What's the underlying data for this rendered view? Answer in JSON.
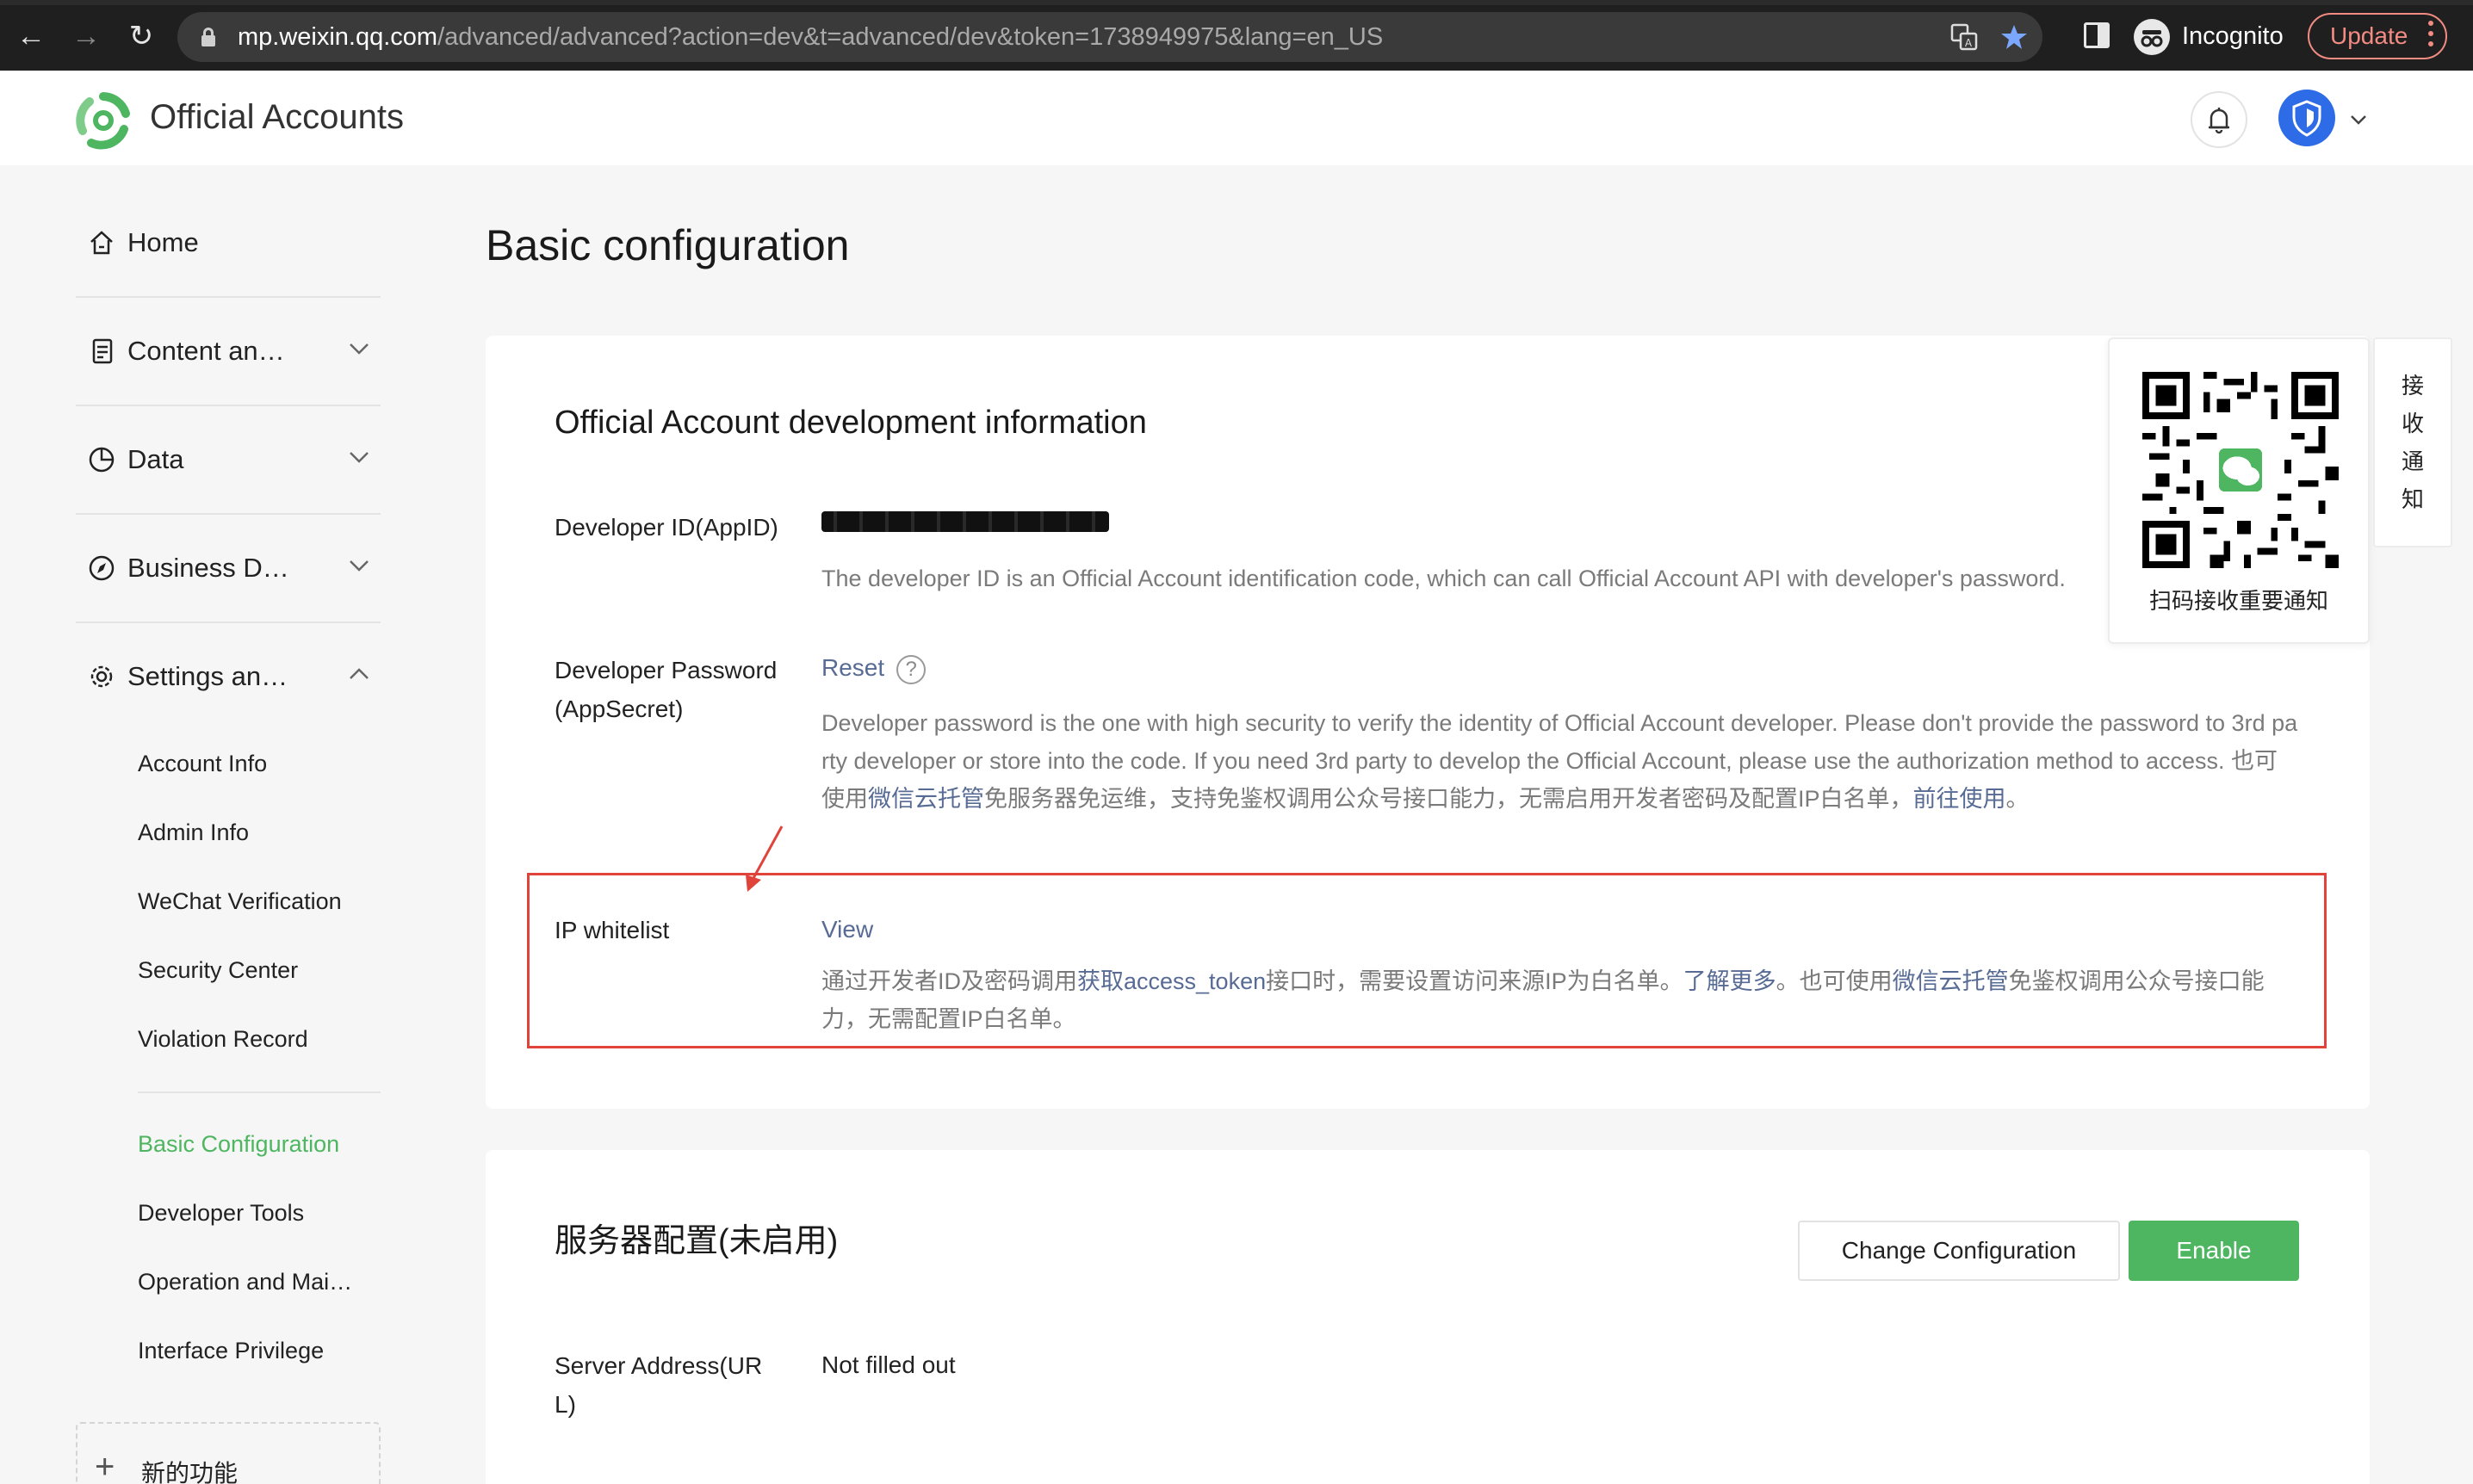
{
  "browser": {
    "url_host": "mp.weixin.qq.com",
    "url_path": "/advanced/advanced?action=dev&t=advanced/dev&token=1738949975&lang=en_US",
    "incognito_label": "Incognito",
    "update_label": "Update",
    "colors": {
      "frame": "#1f1f1f",
      "omnibox": "#3a3a3a",
      "update": "#f28b82",
      "star": "#7ba7ff"
    }
  },
  "header": {
    "brand": "Official Accounts",
    "colors": {
      "logo_green": "#4eb660",
      "avatar_blue": "#2e6be6"
    }
  },
  "sidebar": {
    "items": [
      {
        "label": "Home",
        "icon": "home-icon"
      },
      {
        "label": "Content and Interaction",
        "icon": "document-icon",
        "expanded": false
      },
      {
        "label": "Data",
        "icon": "pie-chart-icon",
        "expanded": false
      },
      {
        "label": "Business Development",
        "icon": "compass-icon",
        "expanded": false
      },
      {
        "label": "Settings and Development",
        "icon": "gear-icon",
        "expanded": true
      }
    ],
    "settings_children": [
      "Account Info",
      "Admin Info",
      "WeChat Verification",
      "Security Center",
      "Violation Record"
    ],
    "dev_children": [
      "Basic Configuration",
      "Developer Tools",
      "Operation and Maintenance",
      "Interface Privilege"
    ],
    "active": "Basic Configuration",
    "new_feature": "新的功能",
    "active_color": "#4eb660"
  },
  "main": {
    "page_title": "Basic configuration",
    "dev_info": {
      "title": "Official Account development information",
      "appid_label": "Developer ID(AppID)",
      "appid_desc": "The developer ID is an Official Account identification code, which can call Official Account API with developer's password.",
      "secret_label": "Developer Password(AppSecret)",
      "secret_action": "Reset",
      "secret_help": "?",
      "secret_desc_1": "Developer password is the one with high security to verify the identity of Official Account developer. Please don't provide the password to 3rd party developer or store into the code. If you need 3rd party to develop the Official Account, please use the authorization method to access. 也可使用",
      "secret_desc_link_1": "微信云托管",
      "secret_desc_2": "免服务器免运维，支持免鉴权调用公众号接口能力，无需启用开发者密码及配置IP白名单，",
      "secret_desc_link_2": "前往使用",
      "secret_desc_3": "。",
      "ip_label": "IP whitelist",
      "ip_action": "View",
      "ip_desc_1": "通过开发者ID及密码调用",
      "ip_desc_link_1": "获取access_token",
      "ip_desc_2": "接口时，需要设置访问来源IP为白名单。",
      "ip_desc_link_2": "了解更多",
      "ip_desc_3": "。也可使用",
      "ip_desc_link_3": "微信云托管",
      "ip_desc_4": "免鉴权调用公众号接口能力，无需配置IP白名单。"
    },
    "server": {
      "title": "服务器配置(未启用)",
      "change_button": "Change Configuration",
      "enable_button": "Enable",
      "url_label": "Server Address(URL)",
      "url_value": "Not filled out"
    },
    "link_color": "#576b95",
    "highlight_color": "#e0433a"
  },
  "qr_popup": {
    "caption": "扫码接收重要通知",
    "tab_chars": [
      "接",
      "收",
      "通",
      "知"
    ]
  }
}
